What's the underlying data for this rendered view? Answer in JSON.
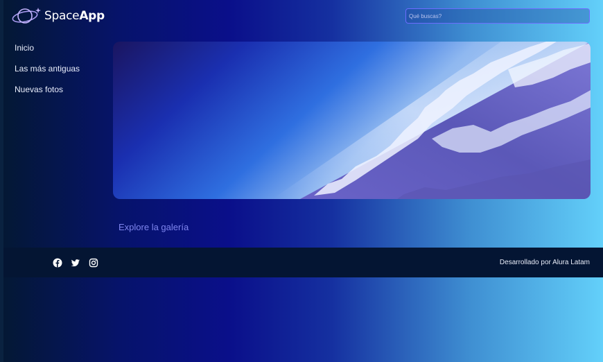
{
  "brand": {
    "name_regular": "Space",
    "name_bold": "App",
    "logo_icon": "planet-icon"
  },
  "search": {
    "placeholder": "Qué buscas?"
  },
  "sidebar": {
    "items": [
      {
        "label": "Inicio"
      },
      {
        "label": "Las más antiguas"
      },
      {
        "label": "Nuevas fotos"
      }
    ]
  },
  "banner": {
    "subject": "earth-horizon-from-space"
  },
  "main": {
    "explore_label": "Explore la galería"
  },
  "footer": {
    "social_icons": [
      "facebook-icon",
      "twitter-icon",
      "instagram-icon"
    ],
    "credit": "Desarrollado por Alura Latam"
  },
  "colors": {
    "gradient_dark": "#041833",
    "gradient_mid": "#0a0f8a",
    "gradient_light": "#63d0fa",
    "footer_bg": "#041533",
    "accent_link": "#7f86ef",
    "search_border": "#6c6cff"
  }
}
